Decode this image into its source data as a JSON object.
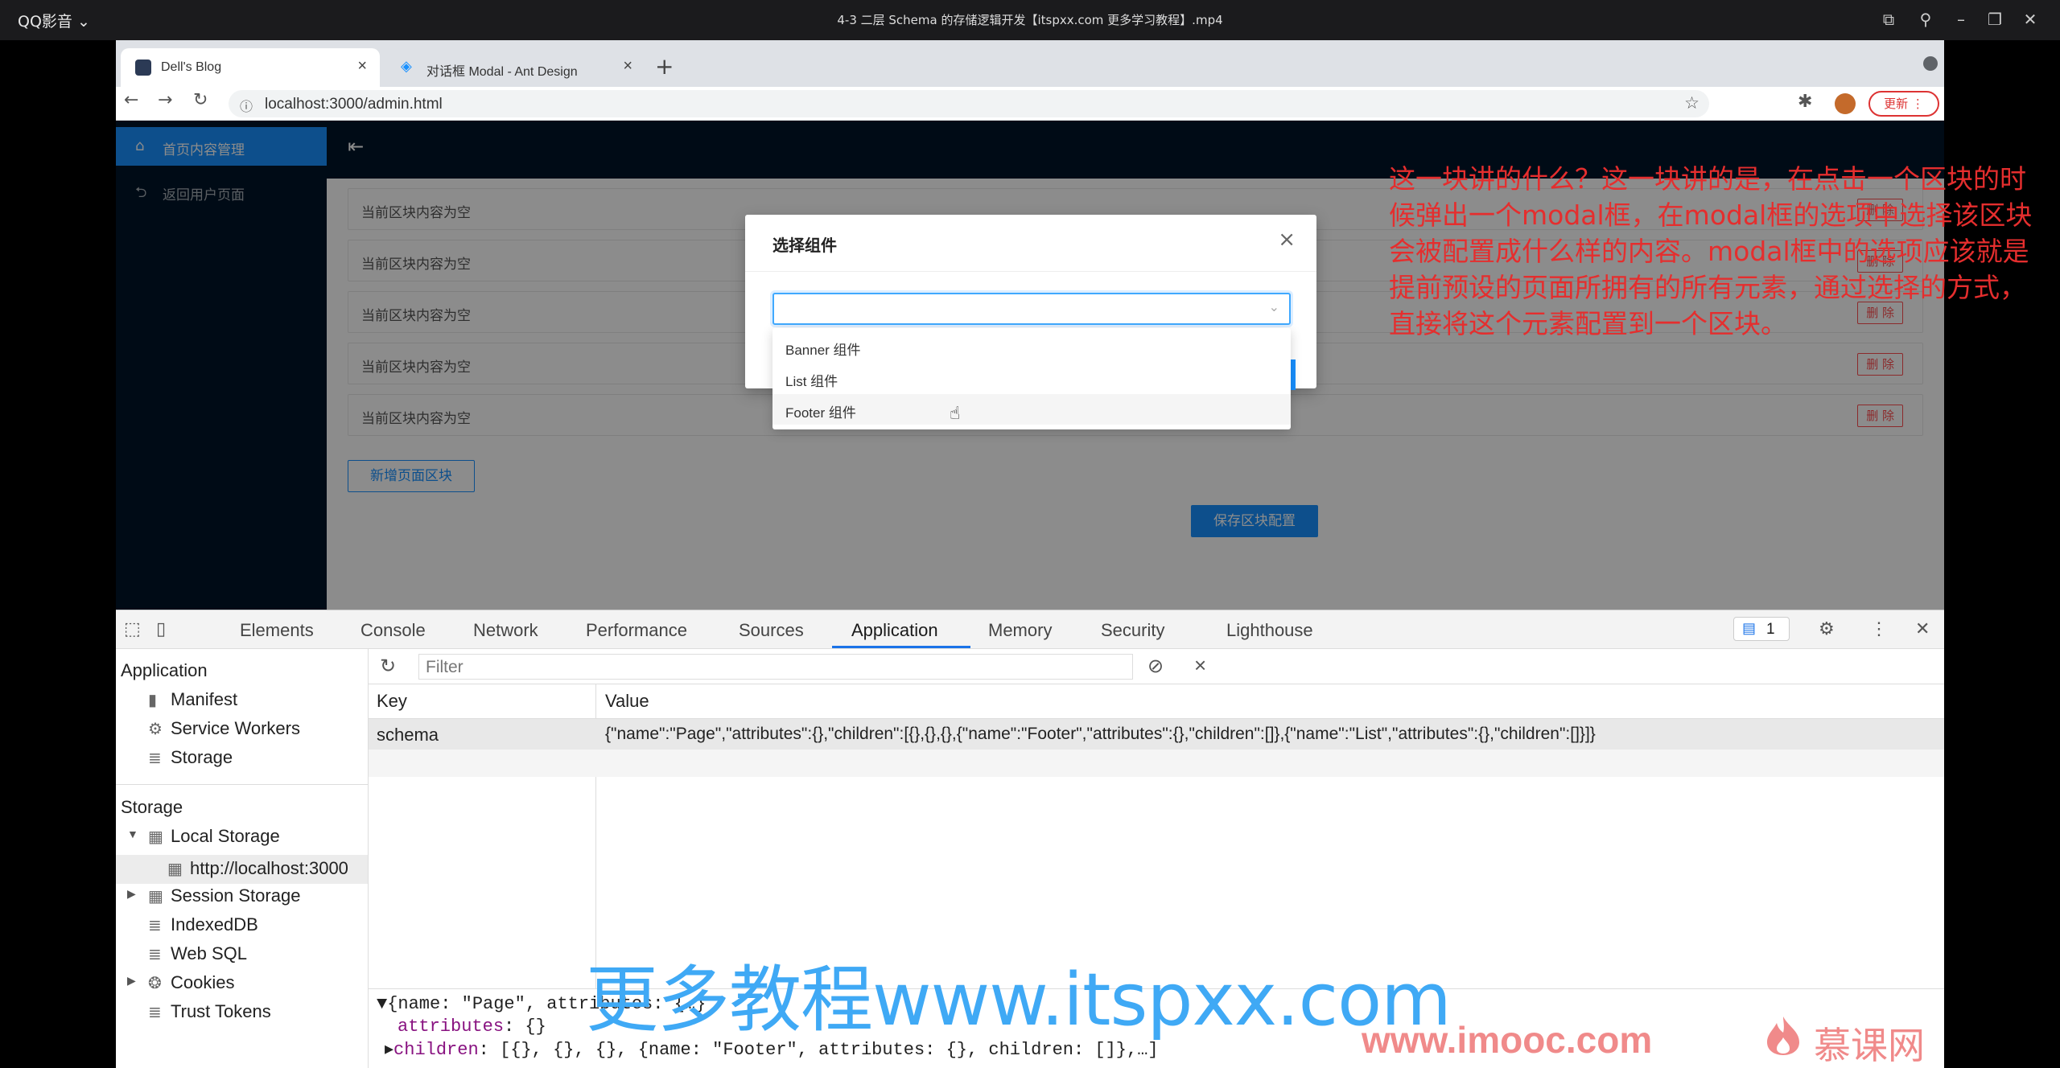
{
  "player": {
    "app_name": "QQ影音",
    "title": "4-3 二层 Schema 的存储逻辑开发【itspxx.com 更多学习教程】.mp4"
  },
  "browser": {
    "tabs": [
      {
        "label": "Dell's Blog",
        "active": true
      },
      {
        "label": "对话框 Modal - Ant Design",
        "active": false
      }
    ],
    "url": "localhost:3000/admin.html",
    "update_label": "更新"
  },
  "admin": {
    "menu": [
      {
        "label": "首页内容管理",
        "icon": "home-icon",
        "selected": true
      },
      {
        "label": "返回用户页面",
        "icon": "rollback-icon",
        "selected": false
      }
    ],
    "areas": [
      {
        "text": "当前区块内容为空",
        "delete_label": "删 除"
      },
      {
        "text": "当前区块内容为空",
        "delete_label": "删 除"
      },
      {
        "text": "当前区块内容为空",
        "delete_label": "删 除"
      },
      {
        "text": "当前区块内容为空",
        "delete_label": "删 除"
      },
      {
        "text": "当前区块内容为空",
        "delete_label": "删 除"
      }
    ],
    "add_area_label": "新增页面区块",
    "save_label": "保存区块配置"
  },
  "modal": {
    "title": "选择组件",
    "select_value": "",
    "options": [
      {
        "label": "Banner 组件"
      },
      {
        "label": "List 组件"
      },
      {
        "label": "Footer 组件"
      }
    ]
  },
  "devtools": {
    "tabs": [
      "Elements",
      "Console",
      "Network",
      "Performance",
      "Sources",
      "Application",
      "Memory",
      "Security",
      "Lighthouse"
    ],
    "active_tab": "Application",
    "issues_count": "1",
    "sidebar": {
      "application_heading": "Application",
      "application_items": [
        "Manifest",
        "Service Workers",
        "Storage"
      ],
      "storage_heading": "Storage",
      "local_storage": "Local Storage",
      "local_storage_origin": "http://localhost:3000",
      "storage_items": [
        "Session Storage",
        "IndexedDB",
        "Web SQL",
        "Cookies",
        "Trust Tokens"
      ]
    },
    "filter_placeholder": "Filter",
    "table": {
      "key_header": "Key",
      "value_header": "Value",
      "rows": [
        {
          "key": "schema",
          "value": "{\"name\":\"Page\",\"attributes\":{},\"children\":[{},{},{},{\"name\":\"Footer\",\"attributes\":{},\"children\":[]},{\"name\":\"List\",\"attributes\":{},\"children\":[]}]}"
        }
      ]
    },
    "preview": {
      "line1": "{name: \"Page\", attributes: {…}",
      "line2_key": "attributes",
      "line2_val": ": {}",
      "line3_key": "children",
      "line3_val": ": [{}, {}, {}, {name: \"Footer\", attributes: {}, children: []},…]"
    }
  },
  "annotation": "这一块讲的什么？这一块讲的是，在点击一个区块的时候弹出一个modal框，在modal框的选项中选择该区块会被配置成什么样的内容。modal框中的选项应该就是提前预设的页面所拥有的所有元素，通过选择的方式，直接将这个元素配置到一个区块。",
  "watermarks": {
    "blue": "更多教程www.itspxx.com",
    "imooc": "www.imooc.com",
    "mooc_brand": "慕课网"
  }
}
